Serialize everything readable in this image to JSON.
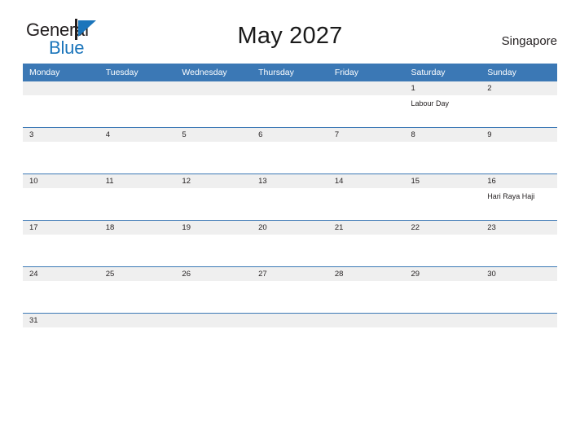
{
  "brand": {
    "line1": "General",
    "line2": "Blue",
    "flag_icon": "blue-triangle-flag",
    "color_dark": "#231f20",
    "color_blue": "#1b75bb"
  },
  "header": {
    "title": "May 2027",
    "location": "Singapore"
  },
  "theme": {
    "header_blue": "#3b78b5",
    "band_gray": "#efefef",
    "text": "#231f20"
  },
  "weekdays": [
    "Monday",
    "Tuesday",
    "Wednesday",
    "Thursday",
    "Friday",
    "Saturday",
    "Sunday"
  ],
  "weeks": [
    [
      {
        "day": "",
        "event": ""
      },
      {
        "day": "",
        "event": ""
      },
      {
        "day": "",
        "event": ""
      },
      {
        "day": "",
        "event": ""
      },
      {
        "day": "",
        "event": ""
      },
      {
        "day": "1",
        "event": "Labour Day"
      },
      {
        "day": "2",
        "event": ""
      }
    ],
    [
      {
        "day": "3",
        "event": ""
      },
      {
        "day": "4",
        "event": ""
      },
      {
        "day": "5",
        "event": ""
      },
      {
        "day": "6",
        "event": ""
      },
      {
        "day": "7",
        "event": ""
      },
      {
        "day": "8",
        "event": ""
      },
      {
        "day": "9",
        "event": ""
      }
    ],
    [
      {
        "day": "10",
        "event": ""
      },
      {
        "day": "11",
        "event": ""
      },
      {
        "day": "12",
        "event": ""
      },
      {
        "day": "13",
        "event": ""
      },
      {
        "day": "14",
        "event": ""
      },
      {
        "day": "15",
        "event": ""
      },
      {
        "day": "16",
        "event": "Hari Raya Haji"
      }
    ],
    [
      {
        "day": "17",
        "event": ""
      },
      {
        "day": "18",
        "event": ""
      },
      {
        "day": "19",
        "event": ""
      },
      {
        "day": "20",
        "event": ""
      },
      {
        "day": "21",
        "event": ""
      },
      {
        "day": "22",
        "event": ""
      },
      {
        "day": "23",
        "event": ""
      }
    ],
    [
      {
        "day": "24",
        "event": ""
      },
      {
        "day": "25",
        "event": ""
      },
      {
        "day": "26",
        "event": ""
      },
      {
        "day": "27",
        "event": ""
      },
      {
        "day": "28",
        "event": ""
      },
      {
        "day": "29",
        "event": ""
      },
      {
        "day": "30",
        "event": ""
      }
    ],
    [
      {
        "day": "31",
        "event": ""
      },
      {
        "day": "",
        "event": ""
      },
      {
        "day": "",
        "event": ""
      },
      {
        "day": "",
        "event": ""
      },
      {
        "day": "",
        "event": ""
      },
      {
        "day": "",
        "event": ""
      },
      {
        "day": "",
        "event": ""
      }
    ]
  ]
}
